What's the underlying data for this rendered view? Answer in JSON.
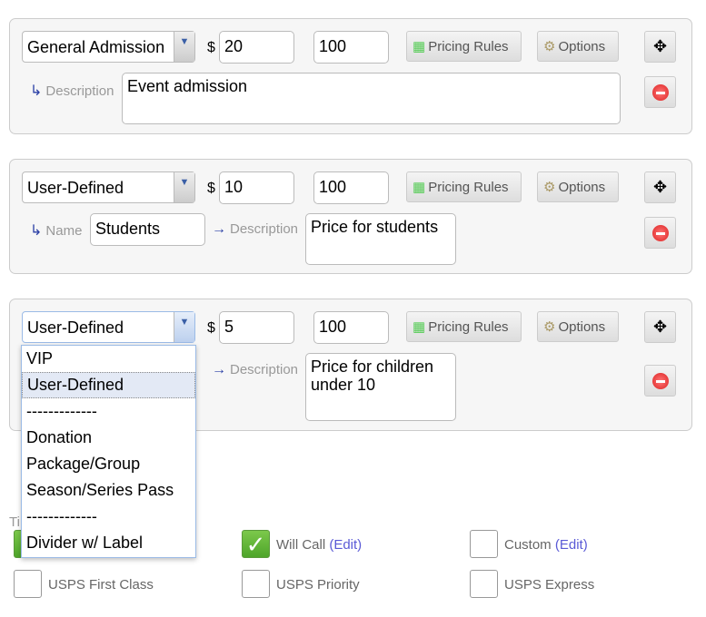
{
  "tickets": [
    {
      "type": "General Admission",
      "price": "20",
      "quantity": "100",
      "description_label": "Description",
      "description": "Event admission"
    },
    {
      "type": "User-Defined",
      "price": "10",
      "quantity": "100",
      "name_label": "Name",
      "name": "Students",
      "description_label": "Description",
      "description": "Price for students"
    },
    {
      "type": "User-Defined",
      "price": "5",
      "quantity": "100",
      "description_label": "Description",
      "description": "Price for children under 10"
    }
  ],
  "currency": "$",
  "buttons": {
    "pricing_rules": "Pricing Rules",
    "options": "Options"
  },
  "dropdown": {
    "options": [
      "VIP",
      "User-Defined",
      "-------------",
      "Donation",
      "Package/Group",
      "Season/Series Pass",
      "-------------",
      "Divider w/ Label"
    ],
    "selected": "User-Defined"
  },
  "section_label_partial": "Ti",
  "delivery": [
    {
      "label": "Will Call",
      "edit": "(Edit)",
      "checked": true
    },
    {
      "label": "Custom",
      "edit": "(Edit)",
      "checked": false
    },
    {
      "label": "USPS First Class",
      "checked": false
    },
    {
      "label": "USPS Priority",
      "checked": false
    },
    {
      "label": "USPS Express",
      "checked": false
    }
  ],
  "colors": {
    "accent": "#2a3fa6",
    "check_green": "#5cb536",
    "link": "#5a5ad6"
  }
}
